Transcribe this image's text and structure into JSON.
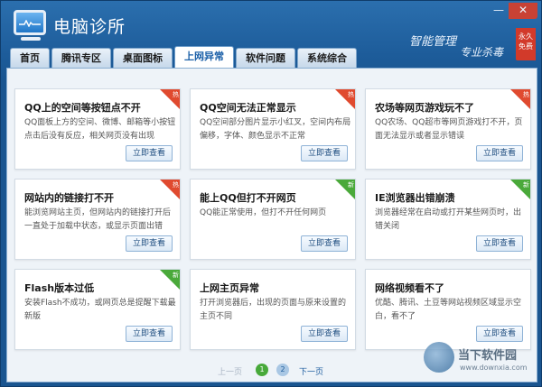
{
  "app": {
    "title": "电脑诊所",
    "slogan_line1": "智能管理",
    "slogan_line2": "专业杀毒",
    "ribbon": "永久免费"
  },
  "window_controls": {
    "minimize": "—",
    "close": "✕"
  },
  "tabs": [
    {
      "label": "首页",
      "active": false
    },
    {
      "label": "腾讯专区",
      "active": false
    },
    {
      "label": "桌面图标",
      "active": false
    },
    {
      "label": "上网异常",
      "active": true
    },
    {
      "label": "软件问题",
      "active": false
    },
    {
      "label": "系统综合",
      "active": false
    }
  ],
  "cards": [
    {
      "title": "QQ上的空间等按钮点不开",
      "desc": "QQ面板上方的空间、微博、邮箱等小按钮点击后没有反应，相关网页没有出现",
      "button": "立即查看",
      "tag": "hot",
      "tag_text": "热"
    },
    {
      "title": "QQ空间无法正常显示",
      "desc": "QQ空间部分图片显示小红叉，空间内布局偏移，字体、颜色显示不正常",
      "button": "立即查看",
      "tag": "hot",
      "tag_text": "热"
    },
    {
      "title": "农场等网页游戏玩不了",
      "desc": "QQ农场、QQ超市等网页游戏打不开，页面无法显示或者显示错误",
      "button": "立即查看",
      "tag": "hot",
      "tag_text": "热"
    },
    {
      "title": "网站内的链接打不开",
      "desc": "能浏览网站主页，但网站内的链接打开后一直处于加载中状态，或显示页面出错",
      "button": "立即查看",
      "tag": "hot",
      "tag_text": "热"
    },
    {
      "title": "能上QQ但打不开网页",
      "desc": "QQ能正常使用，但打不开任何网页",
      "button": "立即查看",
      "tag": "new",
      "tag_text": "新"
    },
    {
      "title": "IE浏览器出错崩溃",
      "desc": "浏览器经常在启动或打开某些网页时，出错关闭",
      "button": "立即查看",
      "tag": "new",
      "tag_text": "新"
    },
    {
      "title": "Flash版本过低",
      "desc": "安装Flash不成功，或网页总是提醒下载最新版",
      "button": "立即查看",
      "tag": "new",
      "tag_text": "新"
    },
    {
      "title": "上网主页异常",
      "desc": "打开浏览器后，出现的页面与原来设置的主页不同",
      "button": "立即查看",
      "tag": "",
      "tag_text": ""
    },
    {
      "title": "网络视频看不了",
      "desc": "优酷、腾讯、土豆等网站视频区域显示空白，看不了",
      "button": "立即查看",
      "tag": "",
      "tag_text": ""
    }
  ],
  "pager": {
    "prev": "上一页",
    "page1": "1",
    "page2": "2",
    "next": "下一页"
  },
  "watermark": {
    "name": "当下软件园",
    "url": "www.downxia.com"
  }
}
